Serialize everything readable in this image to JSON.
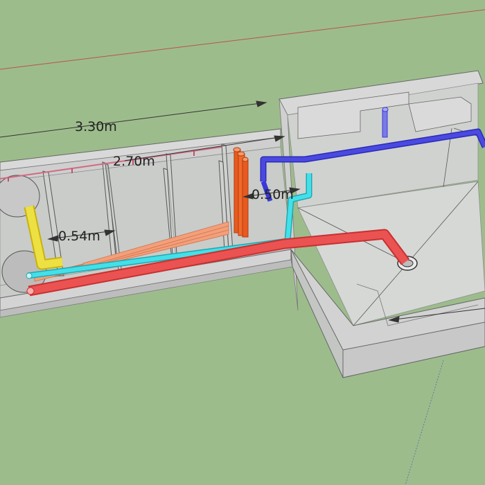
{
  "scene": {
    "background_color": "#9dbc8c",
    "dimensions": [
      {
        "id": "length-total",
        "label": "3.30m"
      },
      {
        "id": "length-inner",
        "label": "2.70m"
      },
      {
        "id": "width-channel",
        "label": "0.54m"
      },
      {
        "id": "width-gap",
        "label": "0.50m"
      }
    ],
    "pipe_colors": {
      "red": "#e8494a",
      "cyan": "#33d6e0",
      "orange": "#f07a3a",
      "blue": "#3a3ad8",
      "yellow": "#e8d82a",
      "salmon": "#f3a07a"
    }
  }
}
